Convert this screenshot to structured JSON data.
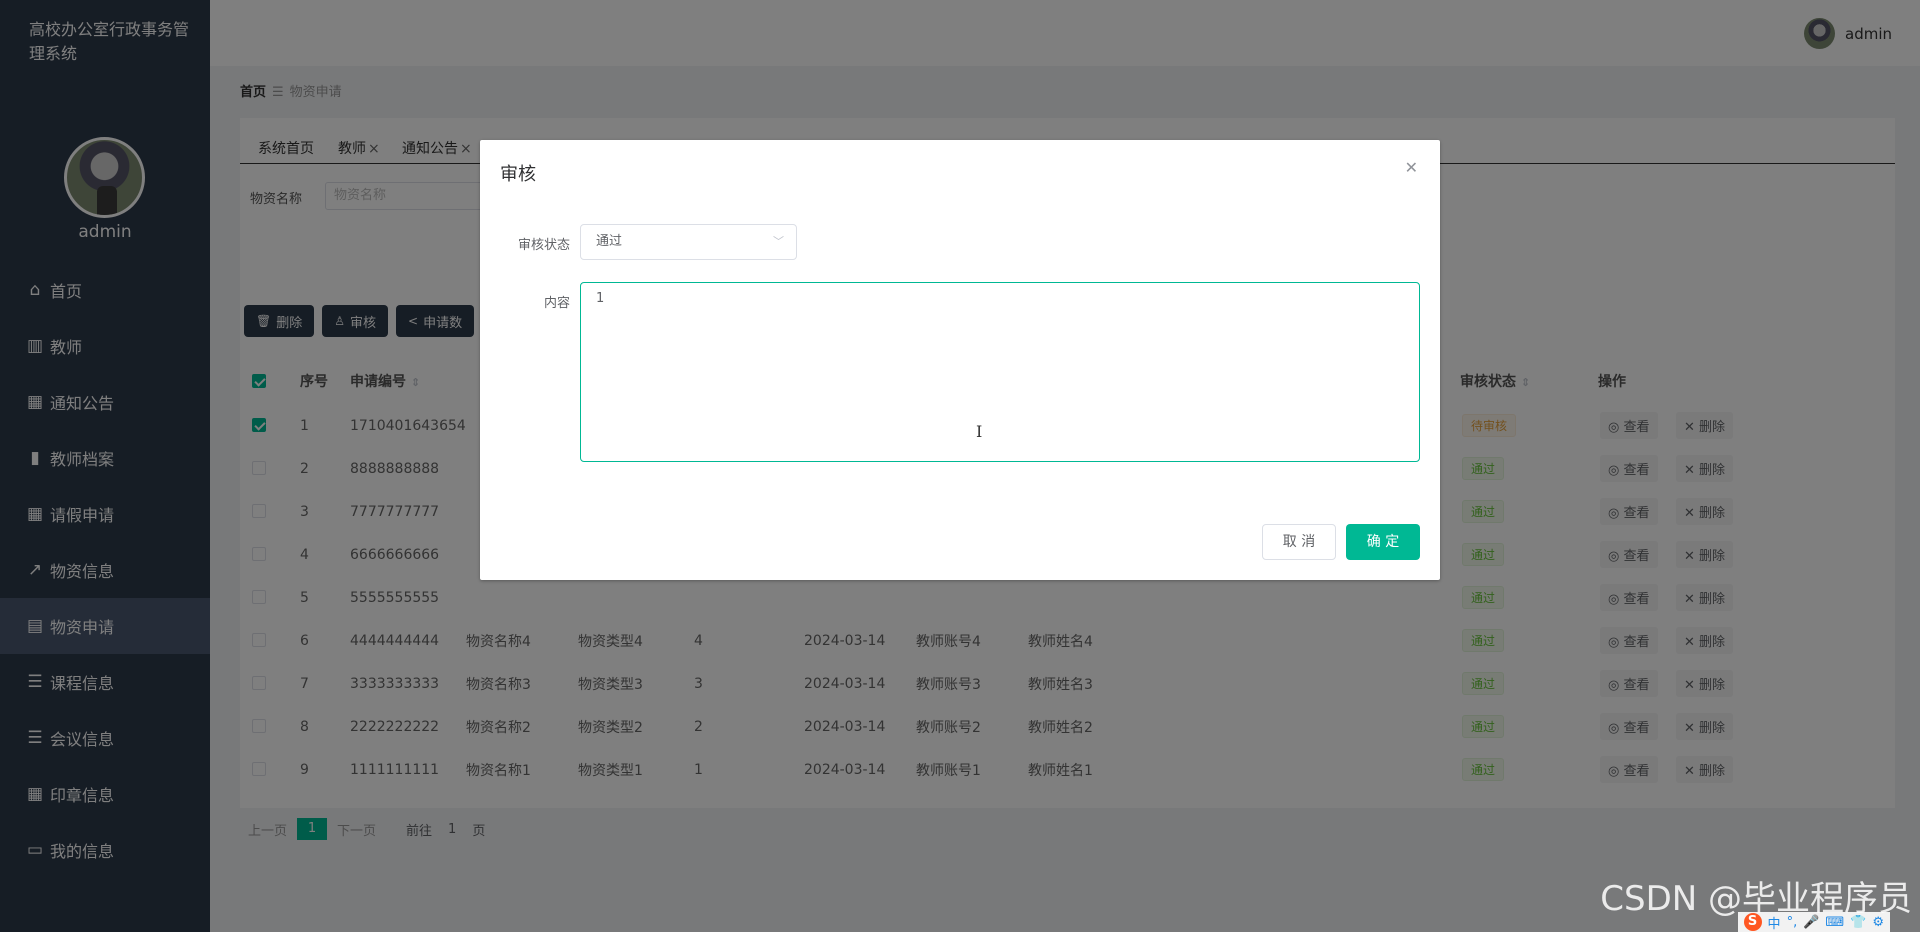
{
  "app": {
    "title": "高校办公室行政事务管理系统",
    "user": "admin"
  },
  "sidebar": {
    "admin_name": "admin",
    "items": [
      {
        "label": "首页",
        "icon": "home-icon"
      },
      {
        "label": "教师",
        "icon": "book-icon"
      },
      {
        "label": "通知公告",
        "icon": "grid-icon"
      },
      {
        "label": "教师档案",
        "icon": "bar-chart-icon"
      },
      {
        "label": "请假申请",
        "icon": "grid-icon"
      },
      {
        "label": "物资信息",
        "icon": "line-chart-icon"
      },
      {
        "label": "物资申请",
        "icon": "clipboard-icon"
      },
      {
        "label": "课程信息",
        "icon": "list-icon"
      },
      {
        "label": "会议信息",
        "icon": "list-icon"
      },
      {
        "label": "印章信息",
        "icon": "grid-icon"
      },
      {
        "label": "我的信息",
        "icon": "card-icon"
      }
    ]
  },
  "breadcrumb": {
    "home": "首页",
    "current": "物资申请"
  },
  "tabs": [
    "系统首页",
    "教师",
    "通知公告"
  ],
  "search": {
    "label": "物资名称",
    "placeholder": "物资名称"
  },
  "toolbar": {
    "delete": "删除",
    "audit": "审核",
    "apply": "申请数"
  },
  "table": {
    "headers": {
      "index": "序号",
      "code": "申请编号",
      "audit_status": "审核状态",
      "ops": "操作"
    },
    "rows": [
      {
        "idx": "1",
        "code": "1710401643654",
        "name": "",
        "type": "",
        "qty": "",
        "date": "",
        "acct": "",
        "tname": "",
        "status": "待审核",
        "checked": true
      },
      {
        "idx": "2",
        "code": "8888888888",
        "name": "",
        "type": "",
        "qty": "",
        "date": "",
        "acct": "",
        "tname": "",
        "status": "通过"
      },
      {
        "idx": "3",
        "code": "7777777777",
        "name": "",
        "type": "",
        "qty": "",
        "date": "",
        "acct": "",
        "tname": "",
        "status": "通过"
      },
      {
        "idx": "4",
        "code": "6666666666",
        "name": "",
        "type": "",
        "qty": "",
        "date": "",
        "acct": "",
        "tname": "",
        "status": "通过"
      },
      {
        "idx": "5",
        "code": "5555555555",
        "name": "",
        "type": "",
        "qty": "",
        "date": "",
        "acct": "",
        "tname": "",
        "status": "通过"
      },
      {
        "idx": "6",
        "code": "4444444444",
        "name": "物资名称4",
        "type": "物资类型4",
        "qty": "4",
        "date": "2024-03-14",
        "acct": "教师账号4",
        "tname": "教师姓名4",
        "status": "通过"
      },
      {
        "idx": "7",
        "code": "3333333333",
        "name": "物资名称3",
        "type": "物资类型3",
        "qty": "3",
        "date": "2024-03-14",
        "acct": "教师账号3",
        "tname": "教师姓名3",
        "status": "通过"
      },
      {
        "idx": "8",
        "code": "2222222222",
        "name": "物资名称2",
        "type": "物资类型2",
        "qty": "2",
        "date": "2024-03-14",
        "acct": "教师账号2",
        "tname": "教师姓名2",
        "status": "通过"
      },
      {
        "idx": "9",
        "code": "1111111111",
        "name": "物资名称1",
        "type": "物资类型1",
        "qty": "1",
        "date": "2024-03-14",
        "acct": "教师账号1",
        "tname": "教师姓名1",
        "status": "通过"
      }
    ],
    "view_label": "查看",
    "delete_label": "删除"
  },
  "pager": {
    "prev": "上一页",
    "page": "1",
    "next": "下一页",
    "goto": "前往",
    "goto_val": "1",
    "unit": "页"
  },
  "dialog": {
    "title": "审核",
    "status_label": "审核状态",
    "status_value": "通过",
    "content_label": "内容",
    "content_value": "1",
    "cancel": "取 消",
    "ok": "确 定"
  },
  "watermark": "CSDN @毕业程序员",
  "colors": {
    "sidebar": "#2d3a4b",
    "accent": "#00b894"
  }
}
